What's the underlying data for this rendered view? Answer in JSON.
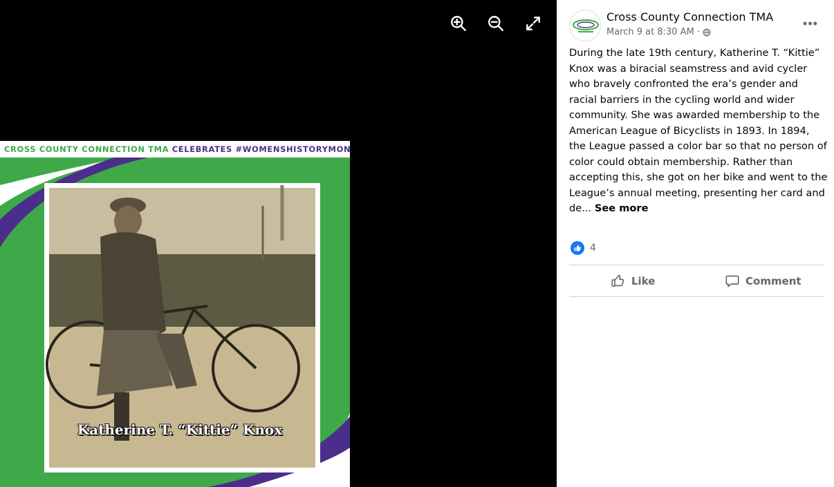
{
  "viewer": {
    "zoom_in_icon": "zoom-in-icon",
    "zoom_out_icon": "zoom-out-icon",
    "fullscreen_icon": "fullscreen-icon"
  },
  "photo": {
    "banner_org": "CROSS COUNTY CONNECTION TMA",
    "banner_rest": "CELEBRATES #WOMENSHISTORYMONTH",
    "caption": "Katherine T. “Kittie” Knox",
    "colors": {
      "green": "#3fa94a",
      "purple": "#4b2e8c",
      "white": "#ffffff"
    }
  },
  "post": {
    "page_name": "Cross County Connection TMA",
    "timestamp": "March 9 at 8:30 AM",
    "separator": "·",
    "privacy_icon": "globe-icon",
    "more_icon": "more-icon",
    "text": "During the late 19th century, Katherine T. “Kittie” Knox was a biracial seamstress and avid cycler who bravely confronted the era’s gender and racial barriers in the cycling world and wider community. She was awarded membership to the American League of Bicyclists in 1893. In 1894, the League passed a color bar so that no person of color could obtain membership. Rather than accepting this, she got on her bike and went to the League’s annual meeting, presenting her card and de...",
    "see_more": "See more",
    "reaction_count": "4",
    "like_label": "Like",
    "comment_label": "Comment",
    "accent_color": "#1877f2"
  }
}
